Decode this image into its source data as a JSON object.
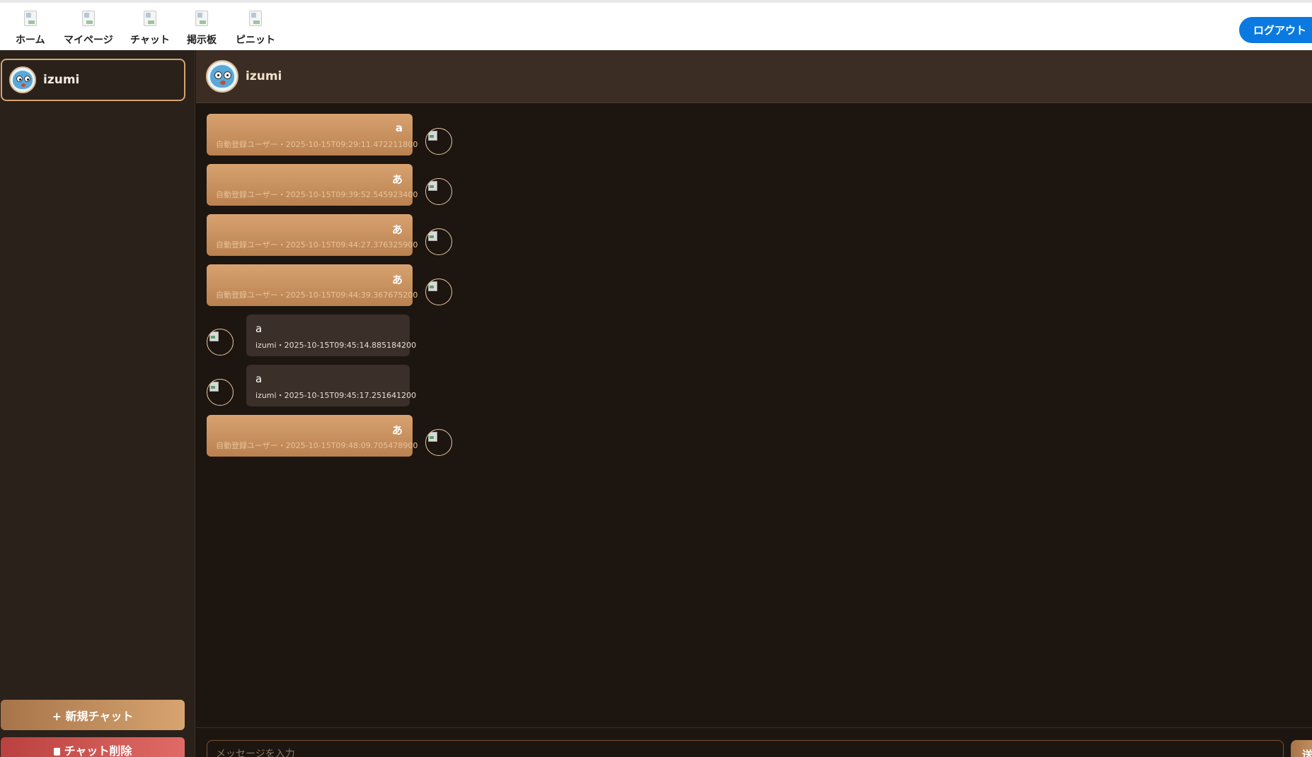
{
  "nav": {
    "items": [
      {
        "label": "ホーム",
        "icon": "home-icon"
      },
      {
        "label": "マイページ",
        "icon": "mypage-icon"
      },
      {
        "label": "チャット",
        "icon": "chat-icon"
      },
      {
        "label": "掲示板",
        "icon": "board-icon"
      },
      {
        "label": "ピニット",
        "icon": "pinit-icon"
      }
    ],
    "logout_label": "ログアウト"
  },
  "sidebar": {
    "chats": [
      {
        "name": "izumi",
        "active": true
      }
    ],
    "new_chat_label": "+ 新規チャット",
    "delete_chat_label": "チャット削除"
  },
  "chat": {
    "partner_name": "izumi",
    "messages": [
      {
        "direction": "sent",
        "text": "a",
        "meta": "自動登録ユーザー・2025-10-15T09:29:11.472211800"
      },
      {
        "direction": "sent",
        "text": "あ",
        "meta": "自動登録ユーザー・2025-10-15T09:39:52.545923400"
      },
      {
        "direction": "sent",
        "text": "あ",
        "meta": "自動登録ユーザー・2025-10-15T09:44:27.376325900"
      },
      {
        "direction": "sent",
        "text": "あ",
        "meta": "自動登録ユーザー・2025-10-15T09:44:39.367675200"
      },
      {
        "direction": "received",
        "text": "a",
        "meta": "izumi・2025-10-15T09:45:14.885184200"
      },
      {
        "direction": "received",
        "text": "a",
        "meta": "izumi・2025-10-15T09:45:17.251641200"
      },
      {
        "direction": "sent",
        "text": "あ",
        "meta": "自動登録ユーザー・2025-10-15T09:48:09.705478900"
      }
    ],
    "input_placeholder": "メッセージを入力",
    "send_label": "送信"
  },
  "colors": {
    "accent": "#d7a470",
    "danger": "#e06b66",
    "logout": "#0b7ae0",
    "background": "#1d1510"
  }
}
